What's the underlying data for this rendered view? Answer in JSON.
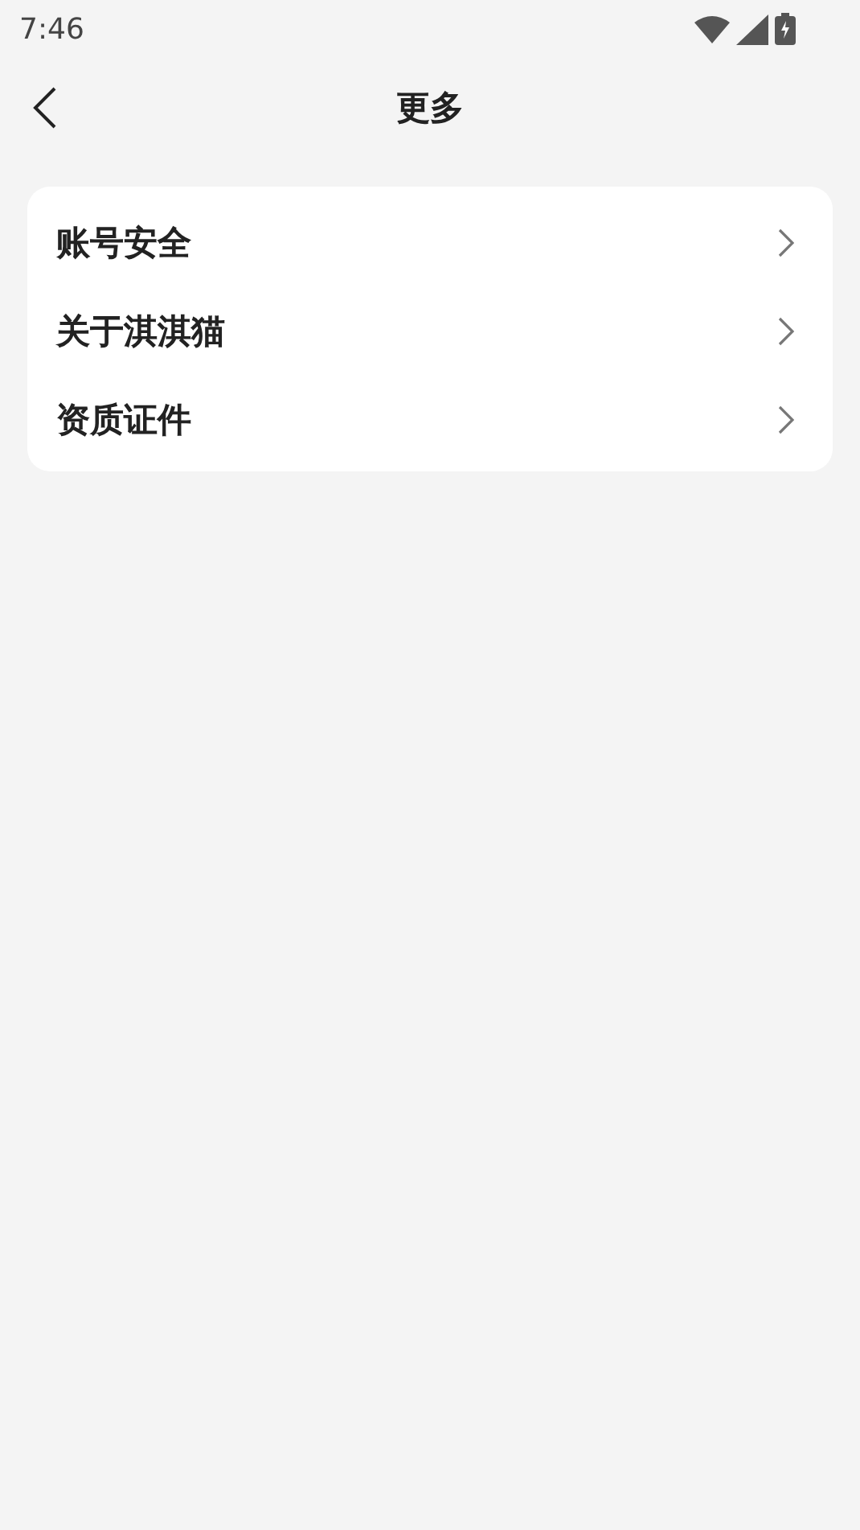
{
  "status_bar": {
    "time": "7:46"
  },
  "header": {
    "title": "更多"
  },
  "menu": [
    {
      "label": "账号安全"
    },
    {
      "label": "关于淇淇猫"
    },
    {
      "label": "资质证件"
    }
  ]
}
